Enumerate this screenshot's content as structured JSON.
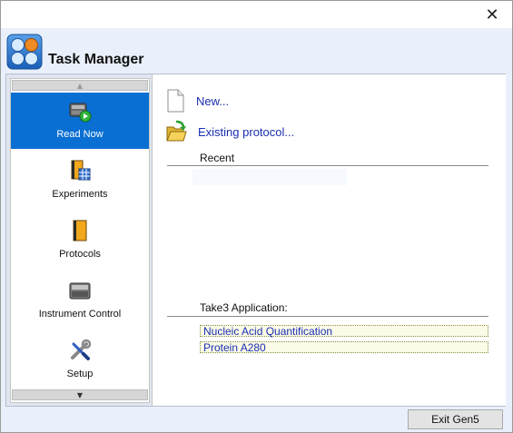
{
  "window": {
    "close_glyph": "✕"
  },
  "header": {
    "title": "Task Manager",
    "icon": "gen5-app-icon"
  },
  "sidebar": {
    "scroll_up_glyph": "▲",
    "scroll_down_glyph": "▼",
    "items": [
      {
        "label": "Read Now",
        "icon": "plate-reader-play-icon",
        "selected": true
      },
      {
        "label": "Experiments",
        "icon": "experiments-book-icon",
        "selected": false
      },
      {
        "label": "Protocols",
        "icon": "protocols-book-icon",
        "selected": false
      },
      {
        "label": "Instrument Control",
        "icon": "instrument-icon",
        "selected": false
      },
      {
        "label": "Setup",
        "icon": "wrench-screwdriver-icon",
        "selected": false
      }
    ]
  },
  "main": {
    "new_label": "New...",
    "existing_label": "Existing protocol...",
    "recent_title": "Recent",
    "take3_title": "Take3 Application:",
    "take3_options": [
      "Nucleic Acid Quantification",
      "Protein A280"
    ]
  },
  "footer": {
    "exit_label": "Exit Gen5"
  },
  "colors": {
    "selected_bg": "#0a6fd2",
    "link": "#1a2fb0",
    "window_bg": "#e9f0fb"
  }
}
